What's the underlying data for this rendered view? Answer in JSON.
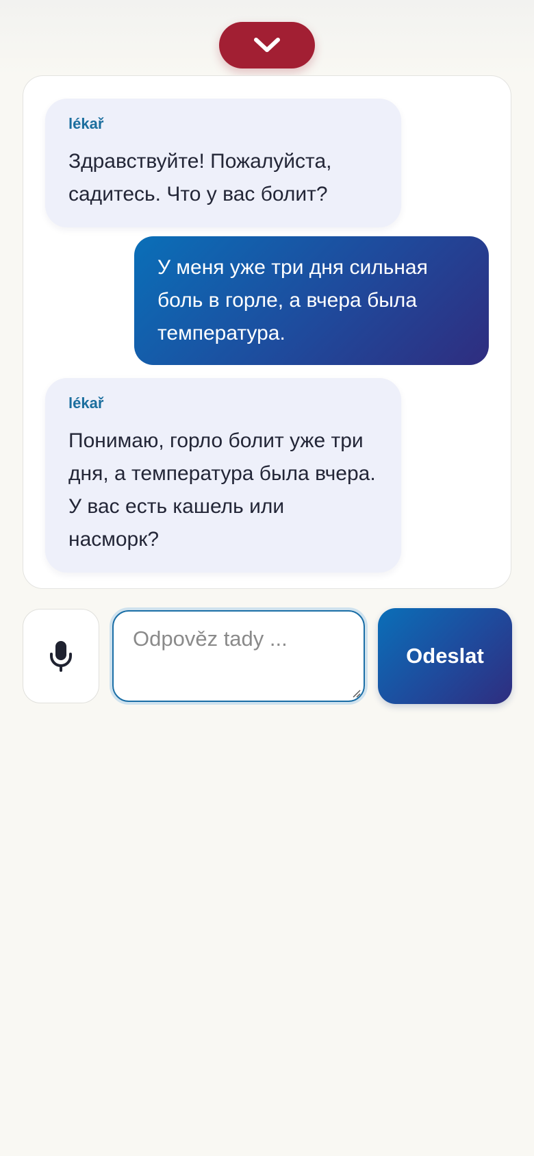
{
  "header": {
    "collapse_icon": "chevron-down-icon",
    "accent_color": "#a21f33"
  },
  "chat": {
    "messages": [
      {
        "role": "bot",
        "sender": "lékař",
        "text": "Здравствуйте! Пожалуйста, садитесь. Что у вас болит?"
      },
      {
        "role": "user",
        "text": "У меня уже три дня сильная боль в горле, а вчера была температура."
      },
      {
        "role": "bot",
        "sender": "lékař",
        "text": "Понимаю, горло болит уже три дня, а температура была вчера. У вас есть кашель или насморк?"
      }
    ]
  },
  "composer": {
    "mic_icon": "microphone-icon",
    "placeholder": "Odpověz tady ...",
    "value": "",
    "send_label": "Odeslat",
    "send_color": "#1f4a9c"
  }
}
